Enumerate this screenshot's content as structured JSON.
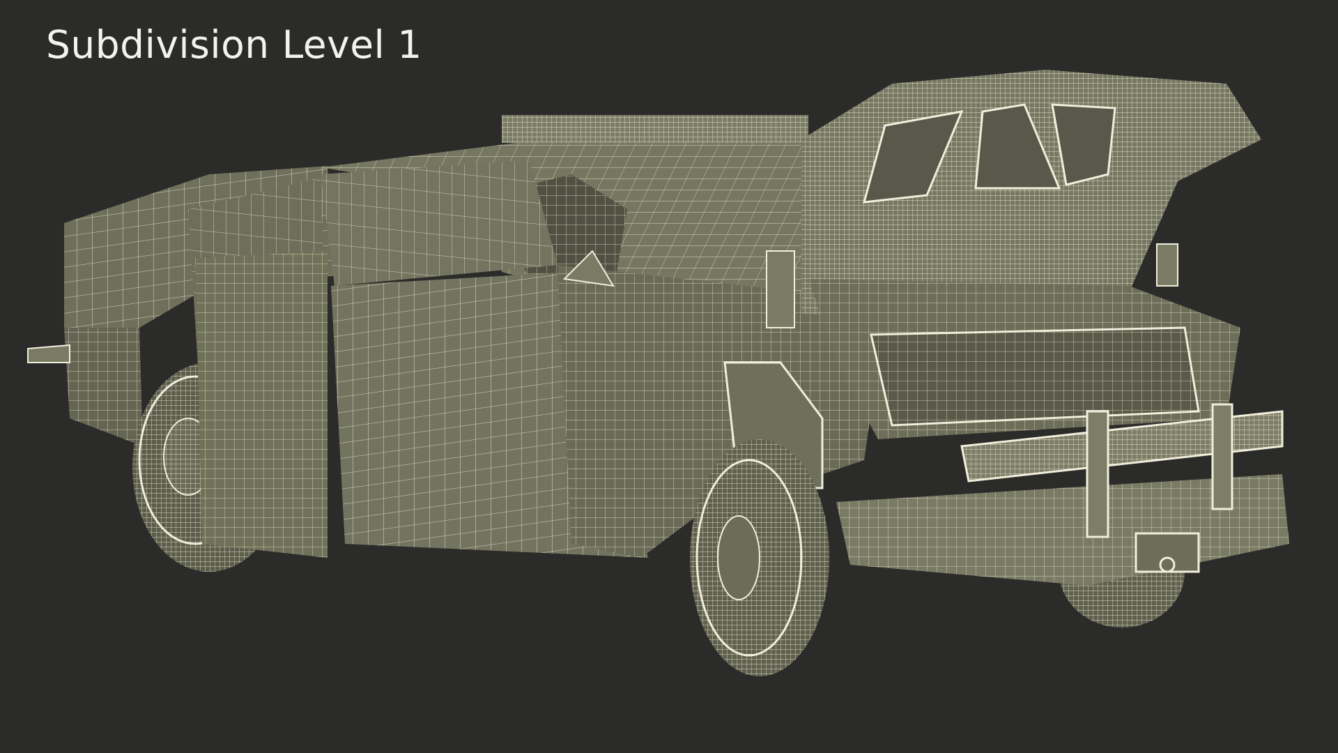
{
  "caption": "Subdivision Level 1",
  "colors": {
    "background": "#2b2b2a",
    "surface": "#75755f",
    "surface_shadow": "#5f604d",
    "wire": "#f1efdc",
    "caption": "#f2f2f0"
  }
}
